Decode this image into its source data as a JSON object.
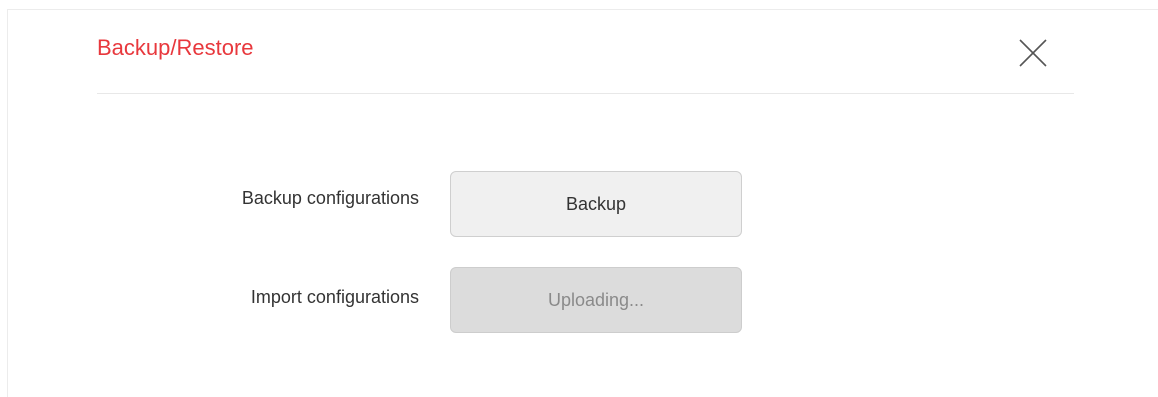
{
  "dialog": {
    "title": "Backup/Restore",
    "close_icon": "close-icon"
  },
  "rows": [
    {
      "label": "Backup configurations",
      "button_label": "Backup",
      "button_state": "enabled"
    },
    {
      "label": "Import configurations",
      "button_label": "Uploading...",
      "button_state": "disabled"
    }
  ],
  "colors": {
    "title": "#e8383d",
    "button_bg": "#f0f0f0",
    "button_disabled_bg": "#dcdcdc"
  }
}
